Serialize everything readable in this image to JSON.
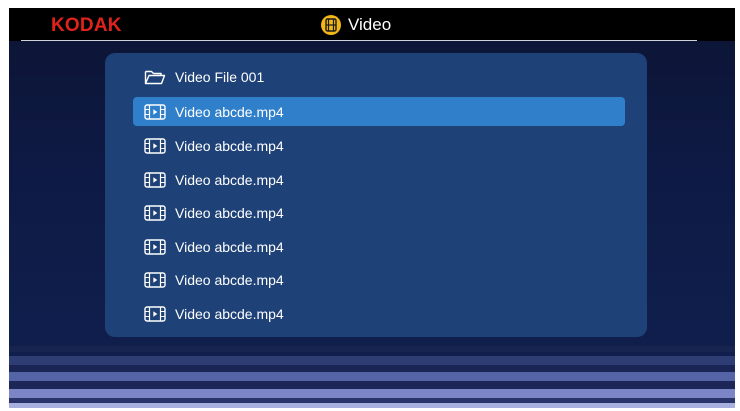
{
  "header": {
    "brand": "KODAK",
    "title": "Video",
    "title_icon": "film-icon"
  },
  "file_list": {
    "items": [
      {
        "label": "Video File 001",
        "icon": "folder-icon",
        "selected": false
      },
      {
        "label": "Video abcde.mp4",
        "icon": "video-file-icon",
        "selected": true
      },
      {
        "label": "Video abcde.mp4",
        "icon": "video-file-icon",
        "selected": false
      },
      {
        "label": "Video abcde.mp4",
        "icon": "video-file-icon",
        "selected": false
      },
      {
        "label": "Video abcde.mp4",
        "icon": "video-file-icon",
        "selected": false
      },
      {
        "label": "Video abcde.mp4",
        "icon": "video-file-icon",
        "selected": false
      },
      {
        "label": "Video abcde.mp4",
        "icon": "video-file-icon",
        "selected": false
      },
      {
        "label": "Video abcde.mp4",
        "icon": "video-file-icon",
        "selected": false
      }
    ]
  },
  "colors": {
    "brand": "#e0221d",
    "selection": "#2f7fca",
    "panel": "#1e4277",
    "title_icon": "#f2b716"
  }
}
